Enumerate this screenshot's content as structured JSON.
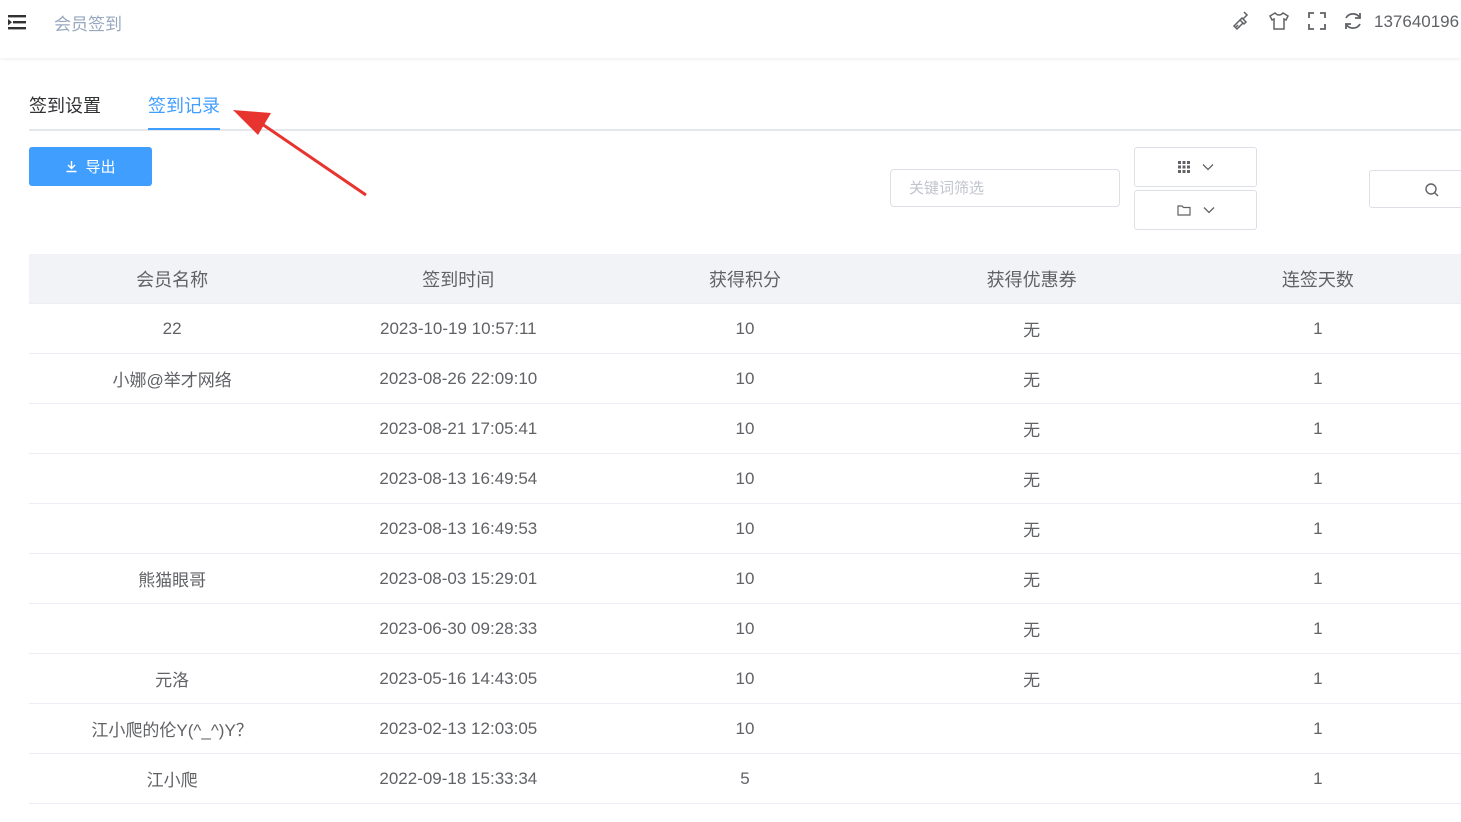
{
  "header": {
    "title": "会员签到",
    "account": "137640196",
    "icons": [
      "menu-fold-icon",
      "brush-icon",
      "shirt-icon",
      "fullscreen-icon",
      "refresh-icon"
    ]
  },
  "tabs": [
    {
      "label": "签到设置",
      "active": false
    },
    {
      "label": "签到记录",
      "active": true
    }
  ],
  "toolbar": {
    "export_label": "导出",
    "search_placeholder": "关键词筛选",
    "search_value": "",
    "icons": [
      "download-icon",
      "columns-grid-icon",
      "folder-icon",
      "search-icon"
    ]
  },
  "table": {
    "columns": [
      "会员名称",
      "签到时间",
      "获得积分",
      "获得优惠券",
      "连签天数"
    ],
    "rows": [
      [
        "22",
        "2023-10-19 10:57:11",
        "10",
        "无",
        "1"
      ],
      [
        "小娜@举才网络",
        "2023-08-26 22:09:10",
        "10",
        "无",
        "1"
      ],
      [
        "",
        "2023-08-21 17:05:41",
        "10",
        "无",
        "1"
      ],
      [
        "",
        "2023-08-13 16:49:54",
        "10",
        "无",
        "1"
      ],
      [
        "",
        "2023-08-13 16:49:53",
        "10",
        "无",
        "1"
      ],
      [
        "熊猫眼哥",
        "2023-08-03 15:29:01",
        "10",
        "无",
        "1"
      ],
      [
        "",
        "2023-06-30 09:28:33",
        "10",
        "无",
        "1"
      ],
      [
        "元洛",
        "2023-05-16 14:43:05",
        "10",
        "无",
        "1"
      ],
      [
        "江小爬的伦Y(^_^)Y？",
        "2023-02-13 12:03:05",
        "10",
        "",
        "1"
      ],
      [
        "江小爬",
        "2022-09-18 15:33:34",
        "5",
        "",
        "1"
      ]
    ]
  },
  "colors": {
    "primary": "#409eff",
    "annotation_arrow": "#e8342f",
    "header_bg": "#f1f3f7"
  }
}
